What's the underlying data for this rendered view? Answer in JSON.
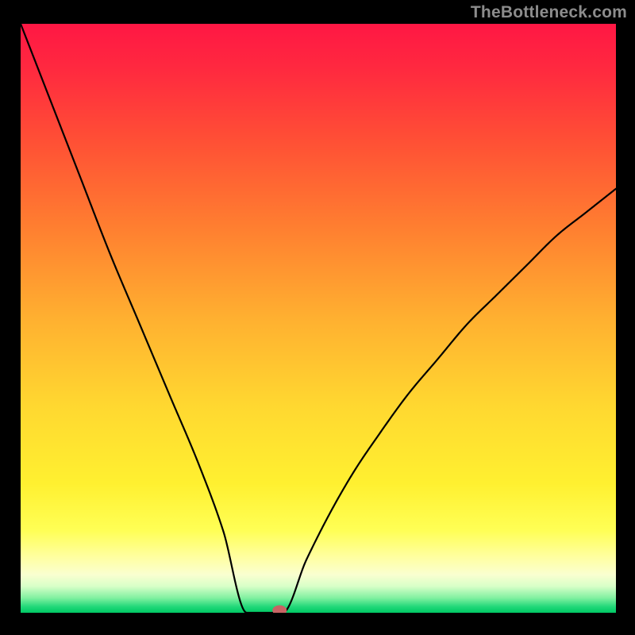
{
  "attribution": "TheBottleneck.com",
  "chart_data": {
    "type": "line",
    "title": "",
    "xlabel": "",
    "ylabel": "",
    "xlim": [
      0,
      100
    ],
    "ylim": [
      0,
      100
    ],
    "optimal_x": 42,
    "marker": {
      "x": 43.5,
      "y": 0,
      "color": "#c86464"
    },
    "flat_bottom": {
      "start_x": 38,
      "end_x": 44
    },
    "series": [
      {
        "name": "bottleneck-curve",
        "x": [
          0,
          5,
          10,
          15,
          20,
          25,
          30,
          34,
          38,
          44,
          48,
          52,
          56,
          60,
          65,
          70,
          75,
          80,
          85,
          90,
          95,
          100
        ],
        "values": [
          100,
          87,
          74,
          61,
          49,
          37,
          25,
          14,
          0,
          0,
          9,
          17,
          24,
          30,
          37,
          43,
          49,
          54,
          59,
          64,
          68,
          72
        ]
      }
    ],
    "gradient_stops": [
      {
        "offset": 0.0,
        "color": "#ff1744"
      },
      {
        "offset": 0.08,
        "color": "#ff2a3f"
      },
      {
        "offset": 0.2,
        "color": "#ff5035"
      },
      {
        "offset": 0.35,
        "color": "#ff8030"
      },
      {
        "offset": 0.5,
        "color": "#ffb030"
      },
      {
        "offset": 0.65,
        "color": "#ffd830"
      },
      {
        "offset": 0.78,
        "color": "#fff030"
      },
      {
        "offset": 0.86,
        "color": "#ffff55"
      },
      {
        "offset": 0.905,
        "color": "#ffffa0"
      },
      {
        "offset": 0.935,
        "color": "#faffd0"
      },
      {
        "offset": 0.955,
        "color": "#d8ffc8"
      },
      {
        "offset": 0.975,
        "color": "#80f0a0"
      },
      {
        "offset": 0.99,
        "color": "#20d878"
      },
      {
        "offset": 1.0,
        "color": "#00c864"
      }
    ]
  }
}
